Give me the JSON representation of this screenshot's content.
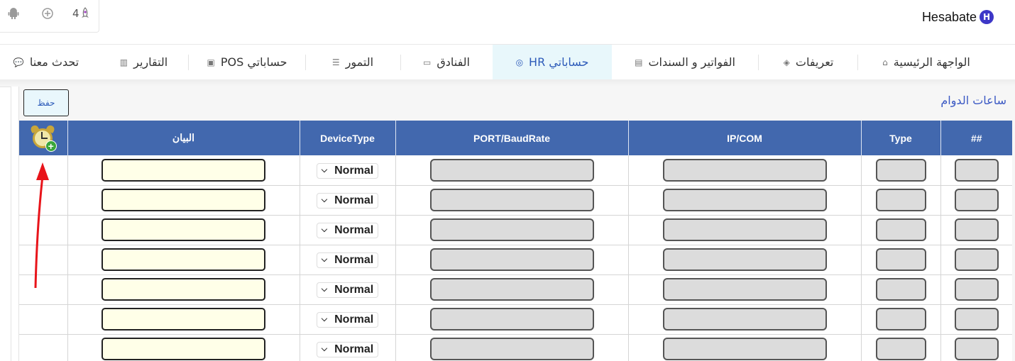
{
  "header": {
    "logo_text": "Hesabate",
    "logo_mark": "H",
    "icons": [
      "android-icon",
      "plus-circle-icon",
      "rocket-icon"
    ],
    "notification_count": "4"
  },
  "nav": {
    "items": [
      {
        "label": "الواجهة الرئيسية",
        "icon": "home-icon"
      },
      {
        "label": "تعريفات",
        "icon": "layers-icon"
      },
      {
        "label": "الفواتير و السندات",
        "icon": "invoice-icon"
      },
      {
        "label": "حساباتي HR",
        "icon": "target-icon",
        "active": true
      },
      {
        "label": "الفنادق",
        "icon": "hotel-icon"
      },
      {
        "label": "التمور",
        "icon": "dates-icon"
      },
      {
        "label": "حساباتي POS",
        "icon": "pos-icon"
      },
      {
        "label": "التقارير",
        "icon": "report-icon"
      },
      {
        "label": "تحدث معنا",
        "icon": "chat-icon"
      }
    ]
  },
  "page": {
    "title": "ساعات الدوام",
    "save_label": "حفظ"
  },
  "table": {
    "columns": [
      "##",
      "Type",
      "IP/COM",
      "PORT/BaudRate",
      "DeviceType",
      "البيان"
    ],
    "device_type_default": "Normal",
    "rows": [
      {
        "num": "",
        "type": "",
        "ip": "",
        "port": "",
        "device": "Normal",
        "desc": ""
      },
      {
        "num": "",
        "type": "",
        "ip": "",
        "port": "",
        "device": "Normal",
        "desc": ""
      },
      {
        "num": "",
        "type": "",
        "ip": "",
        "port": "",
        "device": "Normal",
        "desc": ""
      },
      {
        "num": "",
        "type": "",
        "ip": "",
        "port": "",
        "device": "Normal",
        "desc": ""
      },
      {
        "num": "",
        "type": "",
        "ip": "",
        "port": "",
        "device": "Normal",
        "desc": ""
      },
      {
        "num": "",
        "type": "",
        "ip": "",
        "port": "",
        "device": "Normal",
        "desc": ""
      },
      {
        "num": "",
        "type": "",
        "ip": "",
        "port": "",
        "device": "Normal",
        "desc": ""
      }
    ]
  },
  "colors": {
    "header_blue": "#4268ae",
    "active_tab_bg": "#e8f7fb",
    "accent": "#2d5bb9",
    "arrow": "#e8141a"
  }
}
